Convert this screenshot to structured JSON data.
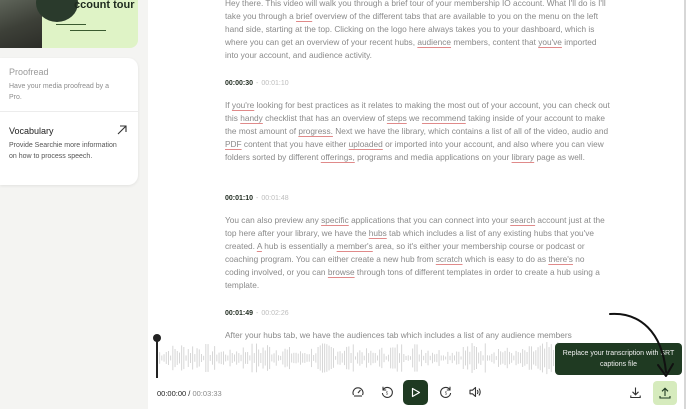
{
  "sidebar": {
    "tour_card": {
      "title": "ccount tour"
    },
    "proofread": {
      "title": "Proofread",
      "description": "Have your media proofread by a Pro."
    },
    "vocabulary": {
      "title": "Vocabulary",
      "description": "Provide Searchie more information on how to process speech."
    }
  },
  "transcript": {
    "paragraphs": [
      {
        "segments": [
          {
            "t": "Hey there. This video will walk you through a brief tour of your membership IO account. What I'll do is I'll take you through a "
          },
          {
            "t": "brief",
            "u": true
          },
          {
            "t": " overview of the different tabs that are available to you on the menu on the left hand side, starting at the top. Clicking on the logo here always takes you to your dashboard, which is where you can get an overview of your recent hubs, "
          },
          {
            "t": "audience",
            "u": true
          },
          {
            "t": " members, content that "
          },
          {
            "t": "you've",
            "u": true
          },
          {
            "t": " imported into your account, and audience activity."
          }
        ]
      },
      {
        "timestamp": {
          "start": "00:00:30",
          "end": "00:01:10"
        },
        "segments": [
          {
            "t": "If "
          },
          {
            "t": "you're",
            "u": true
          },
          {
            "t": " looking for best practices as it relates to making the most out of your account, you can check out this "
          },
          {
            "t": "handy",
            "u": true
          },
          {
            "t": " checklist that has an overview of "
          },
          {
            "t": "steps",
            "u": true
          },
          {
            "t": " we "
          },
          {
            "t": "recommend",
            "u": true
          },
          {
            "t": " taking inside of your account to make the most amount of "
          },
          {
            "t": "progress.",
            "u": true
          },
          {
            "t": " Next we have the library, which contains a list of all of the video, audio and "
          },
          {
            "t": "PDF",
            "u": true
          },
          {
            "t": " content that you have either "
          },
          {
            "t": "uploaded",
            "u": true
          },
          {
            "t": " or imported into your account, and also where you can view folders sorted by different "
          },
          {
            "t": "offerings,",
            "u": true
          },
          {
            "t": " programs and media applications on your "
          },
          {
            "t": "library",
            "u": true
          },
          {
            "t": " page as well."
          }
        ]
      },
      {
        "timestamp": {
          "start": "00:01:10",
          "end": "00:01:48"
        },
        "segments": [
          {
            "t": "You can also preview any "
          },
          {
            "t": "specific",
            "u": true
          },
          {
            "t": " applications that you can connect into your "
          },
          {
            "t": "search",
            "u": true
          },
          {
            "t": " account just at the top here after your library, we have the "
          },
          {
            "t": "hubs",
            "u": true
          },
          {
            "t": " tab which includes a list of any existing hubs that you've created. "
          },
          {
            "t": "A",
            "u": true
          },
          {
            "t": " hub is essentially a "
          },
          {
            "t": "member's",
            "u": true
          },
          {
            "t": " area, so it's either your membership course or podcast or coaching program. You can either create a new hub from "
          },
          {
            "t": "scratch",
            "u": true
          },
          {
            "t": " which is easy to do as "
          },
          {
            "t": "there's",
            "u": true
          },
          {
            "t": " no coding involved, or you can "
          },
          {
            "t": "browse",
            "u": true
          },
          {
            "t": " through tons of different templates in order to create a hub using a template."
          }
        ]
      },
      {
        "timestamp": {
          "start": "00:01:49",
          "end": "00:02:26"
        },
        "segments": [
          {
            "t": "After your hubs tab, we have the audiences tab which includes a list of any audience members"
          }
        ]
      }
    ]
  },
  "player": {
    "current_time": "00:00:00 /",
    "total_time": "00:03:33",
    "buttons": {
      "speed": "speed-icon",
      "rewind": "rewind-5-icon",
      "play": "play-icon",
      "forward": "forward-5-icon",
      "volume": "volume-icon",
      "download": "download-icon",
      "export": "upload-icon"
    }
  },
  "tooltip": {
    "text": "Replace your transcription with SRT captions file"
  },
  "colors": {
    "accent_dark": "#1f3a22",
    "accent_light": "#d6ebbd",
    "tour_card_bg": "#dff3c6",
    "underline": "#e08a8a"
  }
}
